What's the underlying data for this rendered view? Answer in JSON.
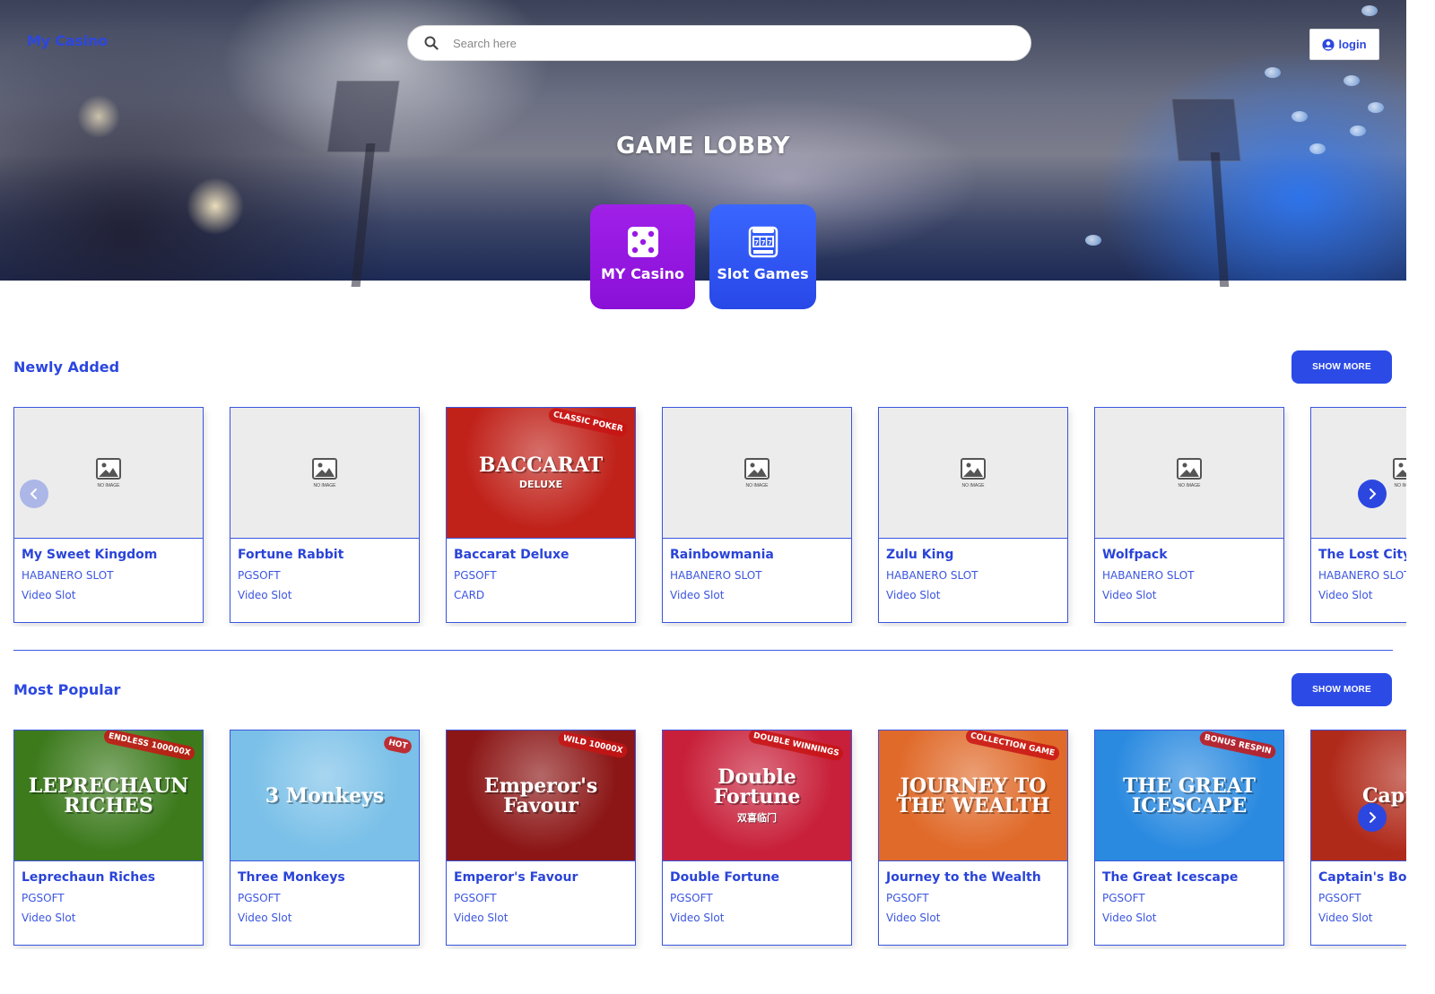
{
  "header": {
    "brand": "My Casino",
    "search_placeholder": "Search here",
    "login_label": "login"
  },
  "hero": {
    "title": "GAME LOBBY",
    "categories": [
      {
        "label": "MY Casino",
        "icon": "dice-icon",
        "color": "#9a18e4"
      },
      {
        "label": "Slot Games",
        "icon": "slot-machine-icon",
        "color": "#2f55f0"
      }
    ]
  },
  "sections": [
    {
      "title": "Newly Added",
      "show_more": "SHOW MORE",
      "games": [
        {
          "name": "My Sweet Kingdom",
          "provider": "HABANERO SLOT",
          "type": "Video Slot",
          "image": "no-image"
        },
        {
          "name": "Fortune Rabbit",
          "provider": "PGSOFT",
          "type": "Video Slot",
          "image": "no-image"
        },
        {
          "name": "Baccarat Deluxe",
          "provider": "PGSOFT",
          "type": "CARD",
          "image": "art",
          "art_text": "BACCARAT",
          "art_sub": "DELUXE",
          "badge": "CLASSIC POKER",
          "art_bg": "#c0221a"
        },
        {
          "name": "Rainbowmania",
          "provider": "HABANERO SLOT",
          "type": "Video Slot",
          "image": "no-image"
        },
        {
          "name": "Zulu King",
          "provider": "HABANERO SLOT",
          "type": "Video Slot",
          "image": "no-image"
        },
        {
          "name": "Wolfpack",
          "provider": "HABANERO SLOT",
          "type": "Video Slot",
          "image": "no-image"
        },
        {
          "name": "The Lost City",
          "provider": "HABANERO SLOT",
          "type": "Video Slot",
          "image": "no-image"
        }
      ]
    },
    {
      "title": "Most Popular",
      "show_more": "SHOW MORE",
      "games": [
        {
          "name": "Leprechaun Riches",
          "provider": "PGSOFT",
          "type": "Video Slot",
          "image": "art",
          "art_text": "LEPRECHAUN RICHES",
          "badge": "ENDLESS 100000X",
          "art_bg": "#3c7a1c"
        },
        {
          "name": "Three Monkeys",
          "provider": "PGSOFT",
          "type": "Video Slot",
          "image": "art",
          "art_text": "3 Monkeys",
          "badge": "HOT",
          "art_bg": "#7ac0e8"
        },
        {
          "name": "Emperor's Favour",
          "provider": "PGSOFT",
          "type": "Video Slot",
          "image": "art",
          "art_text": "Emperor's Favour",
          "badge": "WILD 10000X",
          "art_bg": "#8c1616"
        },
        {
          "name": "Double Fortune",
          "provider": "PGSOFT",
          "type": "Video Slot",
          "image": "art",
          "art_text": "Double Fortune",
          "art_sub": "双喜临门",
          "badge": "DOUBLE WINNINGS",
          "art_bg": "#c8203a"
        },
        {
          "name": "Journey to the Wealth",
          "provider": "PGSOFT",
          "type": "Video Slot",
          "image": "art",
          "art_text": "JOURNEY TO THE WEALTH",
          "badge": "COLLECTION GAME",
          "art_bg": "#e06a2a"
        },
        {
          "name": "The Great Icescape",
          "provider": "PGSOFT",
          "type": "Video Slot",
          "image": "art",
          "art_text": "THE GREAT ICESCAPE",
          "badge": "BONUS RESPIN",
          "art_bg": "#2a8ae0"
        },
        {
          "name": "Captain's Bounty",
          "provider": "PGSOFT",
          "type": "Video Slot",
          "image": "art",
          "art_text": "Captain",
          "art_bg": "#b02a1a"
        }
      ]
    }
  ]
}
